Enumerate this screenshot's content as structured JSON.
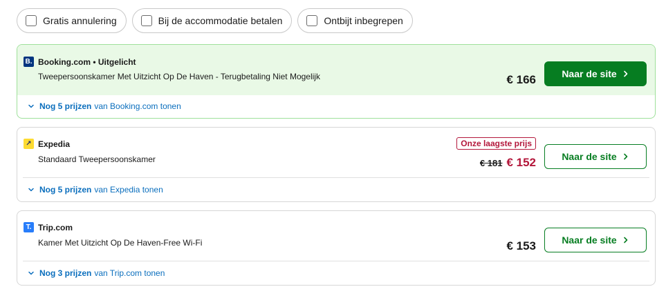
{
  "filters": [
    {
      "label": "Gratis annulering",
      "checked": false
    },
    {
      "label": "Bij de accommodatie betalen",
      "checked": false
    },
    {
      "label": "Ontbijt inbegrepen",
      "checked": false
    }
  ],
  "offers": [
    {
      "provider": "Booking.com • Uitgelicht",
      "logo_letter": "B.",
      "room": "Tweepersoonskamer Met Uitzicht Op De Haven - Terugbetaling Niet Mogelijk",
      "price": "€ 166",
      "button_label": "Naar de site",
      "more_count": "Nog 5 prijzen",
      "more_suffix": "van Booking.com tonen"
    },
    {
      "provider": "Expedia",
      "logo_letter": "↗",
      "room": "Standaard Tweepersoonskamer",
      "badge": "Onze laagste prijs",
      "old_price": "€ 181",
      "price": "€ 152",
      "button_label": "Naar de site",
      "more_count": "Nog 5 prijzen",
      "more_suffix": "van Expedia tonen"
    },
    {
      "provider": "Trip.com",
      "logo_letter": "T.",
      "room": "Kamer Met Uitzicht Op De Haven-Free Wi-Fi",
      "price": "€ 153",
      "button_label": "Naar de site",
      "more_count": "Nog 3 prijzen",
      "more_suffix": "van Trip.com tonen"
    }
  ],
  "colors": {
    "accent_green": "#067d21",
    "featured_bg": "#e9f9e6",
    "deal_red": "#b3163a",
    "link_blue": "#0a6ebd"
  },
  "icons": {
    "checkbox": "checkbox-icon",
    "chevron_right": "chevron-right-icon",
    "chevron_down": "chevron-down-icon"
  }
}
